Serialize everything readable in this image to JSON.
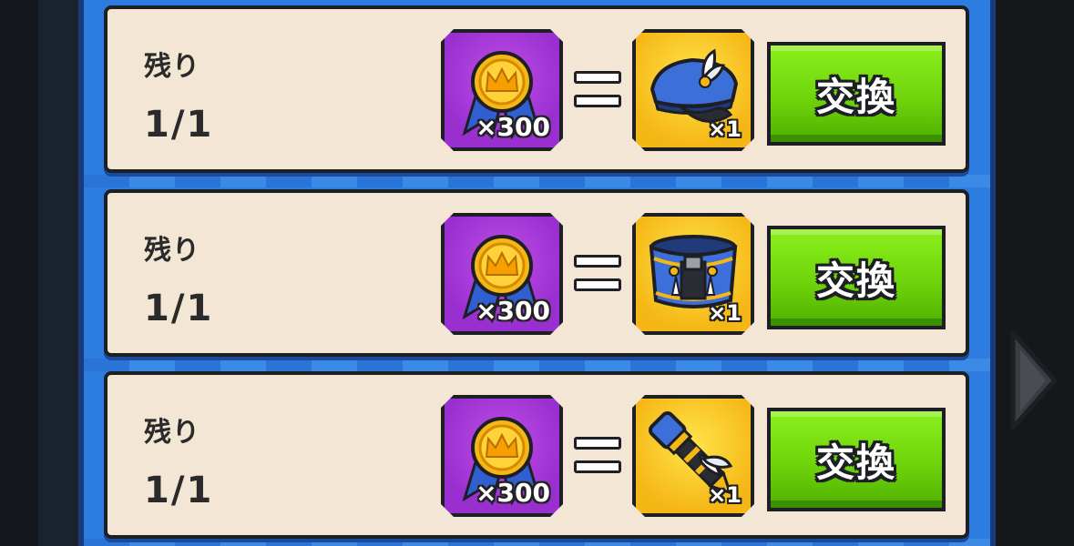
{
  "rows": [
    {
      "remaining_label": "残り",
      "remaining_count": "1/1",
      "cost_icon": "crown-medal-icon",
      "cost_qty": "×300",
      "equals": "=",
      "reward_icon": "police-cap-icon",
      "reward_qty": "×1",
      "button_label": "交換"
    },
    {
      "remaining_label": "残り",
      "remaining_count": "1/1",
      "cost_icon": "crown-medal-icon",
      "cost_qty": "×300",
      "equals": "=",
      "reward_icon": "uniform-belt-icon",
      "reward_qty": "×1",
      "button_label": "交換"
    },
    {
      "remaining_label": "残り",
      "remaining_count": "1/1",
      "cost_icon": "crown-medal-icon",
      "cost_qty": "×300",
      "equals": "=",
      "reward_icon": "baton-telescope-icon",
      "reward_qty": "×1",
      "button_label": "交換"
    }
  ],
  "navigation": {
    "next_icon": "chevron-right-icon"
  },
  "colors": {
    "panel_blue": "#2d7de0",
    "row_bg": "#f3e6d4",
    "cost_purple": "#9a2fd0",
    "reward_gold": "#f5b716",
    "button_green": "#6fd40b"
  }
}
